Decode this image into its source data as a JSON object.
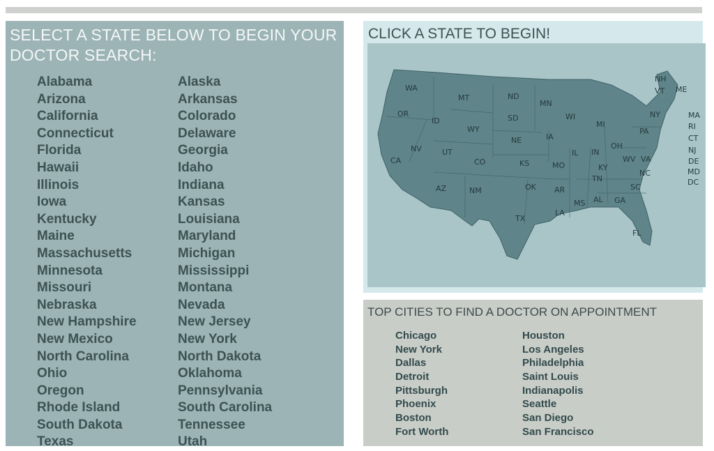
{
  "left_panel": {
    "heading": "SELECT A STATE BELOW TO BEGIN YOUR DOCTOR SEARCH:",
    "column1": [
      "Alabama",
      "Arizona",
      "California",
      "Connecticut",
      "Florida",
      "Hawaii",
      "Illinois",
      "Iowa",
      "Kentucky",
      "Maine",
      "Massachusetts",
      "Minnesota",
      "Missouri",
      "Nebraska",
      "New Hampshire",
      "New Mexico",
      "North Carolina",
      "Ohio",
      "Oregon",
      "Rhode Island",
      "South Dakota",
      "Texas"
    ],
    "column2": [
      "Alaska",
      "Arkansas",
      "Colorado",
      "Delaware",
      "Georgia",
      "Idaho",
      "Indiana",
      "Kansas",
      "Louisiana",
      "Maryland",
      "Michigan",
      "Mississippi",
      "Montana",
      "Nevada",
      "New Jersey",
      "New York",
      "North Dakota",
      "Oklahoma",
      "Pennsylvania",
      "South Carolina",
      "Tennessee",
      "Utah"
    ]
  },
  "map_panel": {
    "heading": "CLICK A STATE TO BEGIN!",
    "states": [
      "WA",
      "OR",
      "CA",
      "ID",
      "NV",
      "MT",
      "WY",
      "UT",
      "AZ",
      "CO",
      "NM",
      "ND",
      "SD",
      "NE",
      "KS",
      "OK",
      "TX",
      "MN",
      "IA",
      "MO",
      "AR",
      "LA",
      "WI",
      "IL",
      "MI",
      "IN",
      "KY",
      "TN",
      "MS",
      "AL",
      "OH",
      "WV",
      "VA",
      "NC",
      "SC",
      "GA",
      "FL",
      "PA",
      "NY",
      "NH",
      "VT",
      "ME",
      "MA",
      "RI",
      "CT",
      "NJ",
      "DE",
      "MD",
      "DC"
    ]
  },
  "cities_panel": {
    "heading": "TOP CITIES TO FIND A DOCTOR ON APPOINTMENT",
    "column1": [
      "Chicago",
      "New York",
      "Dallas",
      "Detroit",
      "Pittsburgh",
      "Phoenix",
      "Boston",
      "Fort Worth"
    ],
    "column2": [
      "Houston",
      "Los Angeles",
      "Philadelphia",
      "Saint Louis",
      "Indianapolis",
      "Seattle",
      "San Diego",
      "San Francisco"
    ]
  }
}
